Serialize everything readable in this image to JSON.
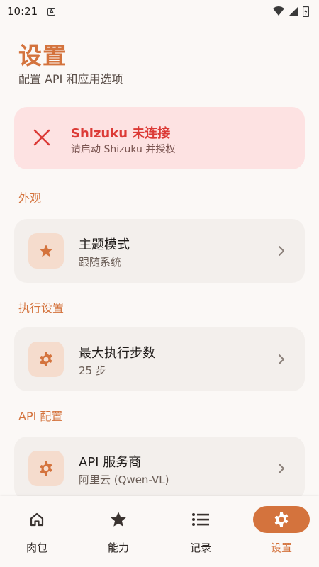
{
  "status_bar": {
    "time": "10:21",
    "notification_icon": "a-icon"
  },
  "header": {
    "title": "设置",
    "subtitle": "配置 API 和应用选项"
  },
  "alert": {
    "title": "Shizuku 未连接",
    "message": "请启动 Shizuku 并授权",
    "color": "#dc3a36"
  },
  "sections": [
    {
      "label": "外观",
      "item": {
        "title": "主题模式",
        "value": "跟随系统",
        "icon": "star-icon"
      }
    },
    {
      "label": "执行设置",
      "item": {
        "title": "最大执行步数",
        "value": "25 步",
        "icon": "gear-icon"
      }
    },
    {
      "label": "API 配置",
      "item": {
        "title": "API 服务商",
        "value": "阿里云 (Qwen-VL)",
        "icon": "gear-icon"
      }
    }
  ],
  "bottom_nav": {
    "items": [
      {
        "label": "肉包",
        "icon": "home-icon"
      },
      {
        "label": "能力",
        "icon": "star-icon"
      },
      {
        "label": "记录",
        "icon": "list-icon"
      },
      {
        "label": "设置",
        "icon": "gear-icon",
        "active": true
      }
    ]
  },
  "colors": {
    "accent": "#d4733d",
    "alert_bg": "#fde2e2",
    "card_bg": "#f3efec",
    "icon_bg": "#f5dccd"
  }
}
